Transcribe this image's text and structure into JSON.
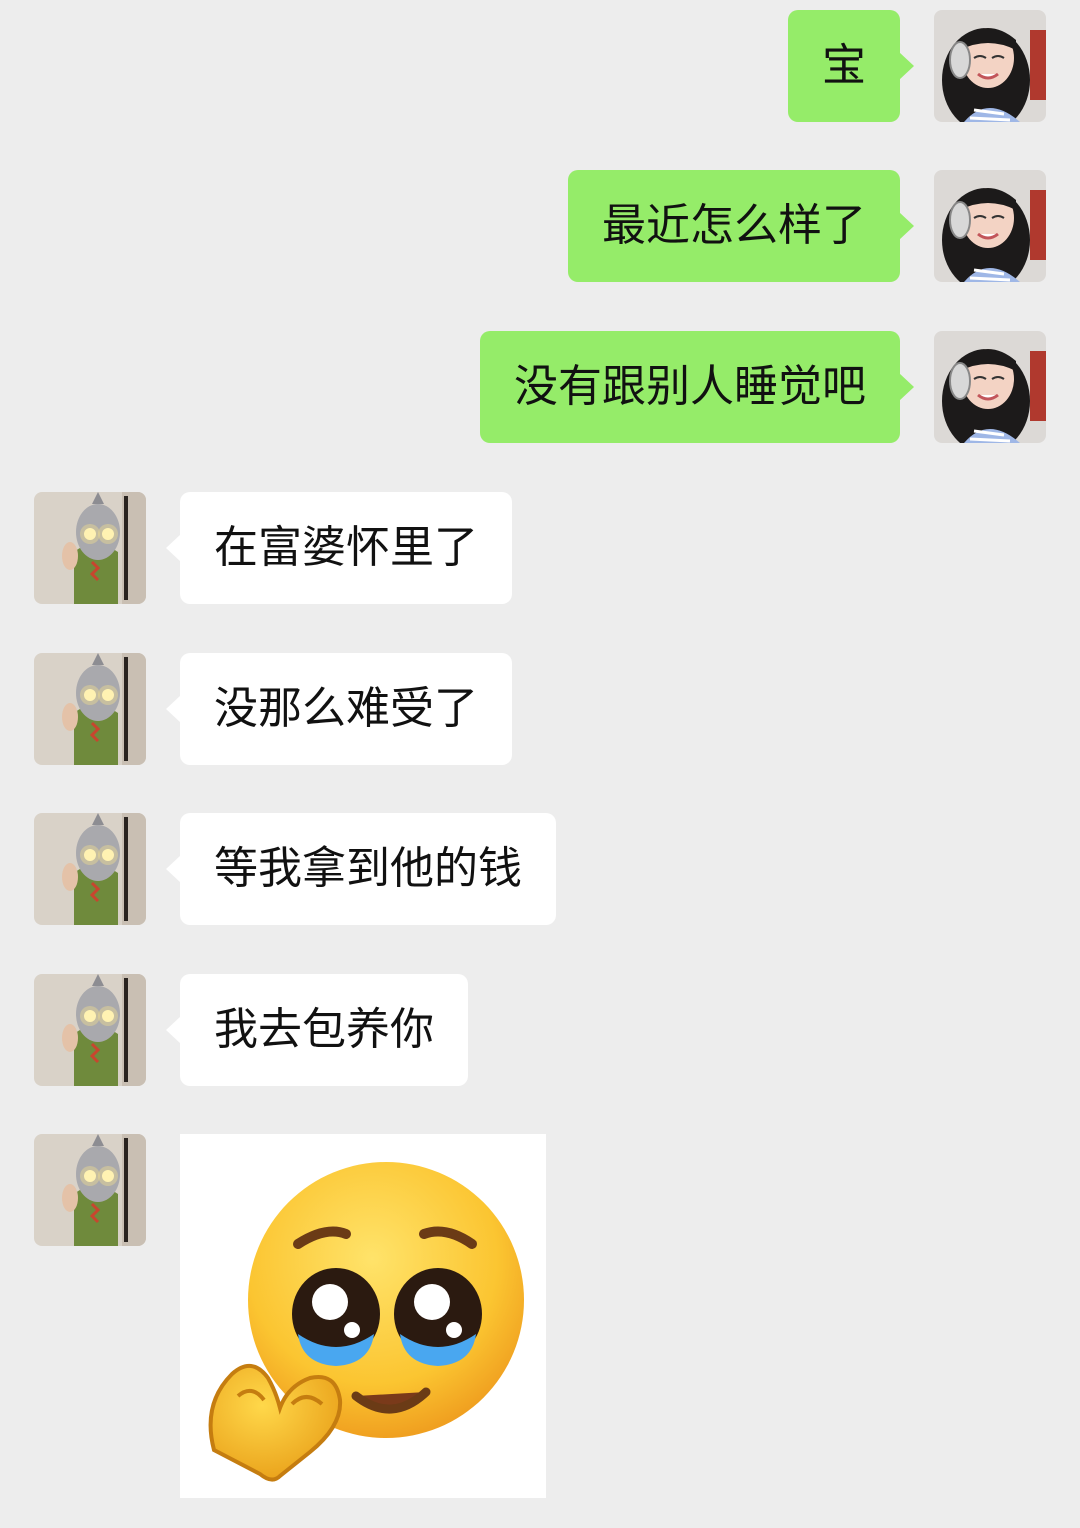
{
  "messages": [
    {
      "side": "out",
      "text": "宝"
    },
    {
      "side": "out",
      "text": "最近怎么样了"
    },
    {
      "side": "out",
      "text": "没有跟别人睡觉吧"
    },
    {
      "side": "in",
      "text": "在富婆怀里了"
    },
    {
      "side": "in",
      "text": "没那么难受了"
    },
    {
      "side": "in",
      "text": "等我拿到他的钱"
    },
    {
      "side": "in",
      "text": "我去包养你"
    }
  ],
  "sticker": {
    "icon": "pleading-face-heart-hands-icon"
  },
  "colors": {
    "outgoing_bubble": "#95ec69",
    "incoming_bubble": "#ffffff",
    "background": "#ededed"
  }
}
